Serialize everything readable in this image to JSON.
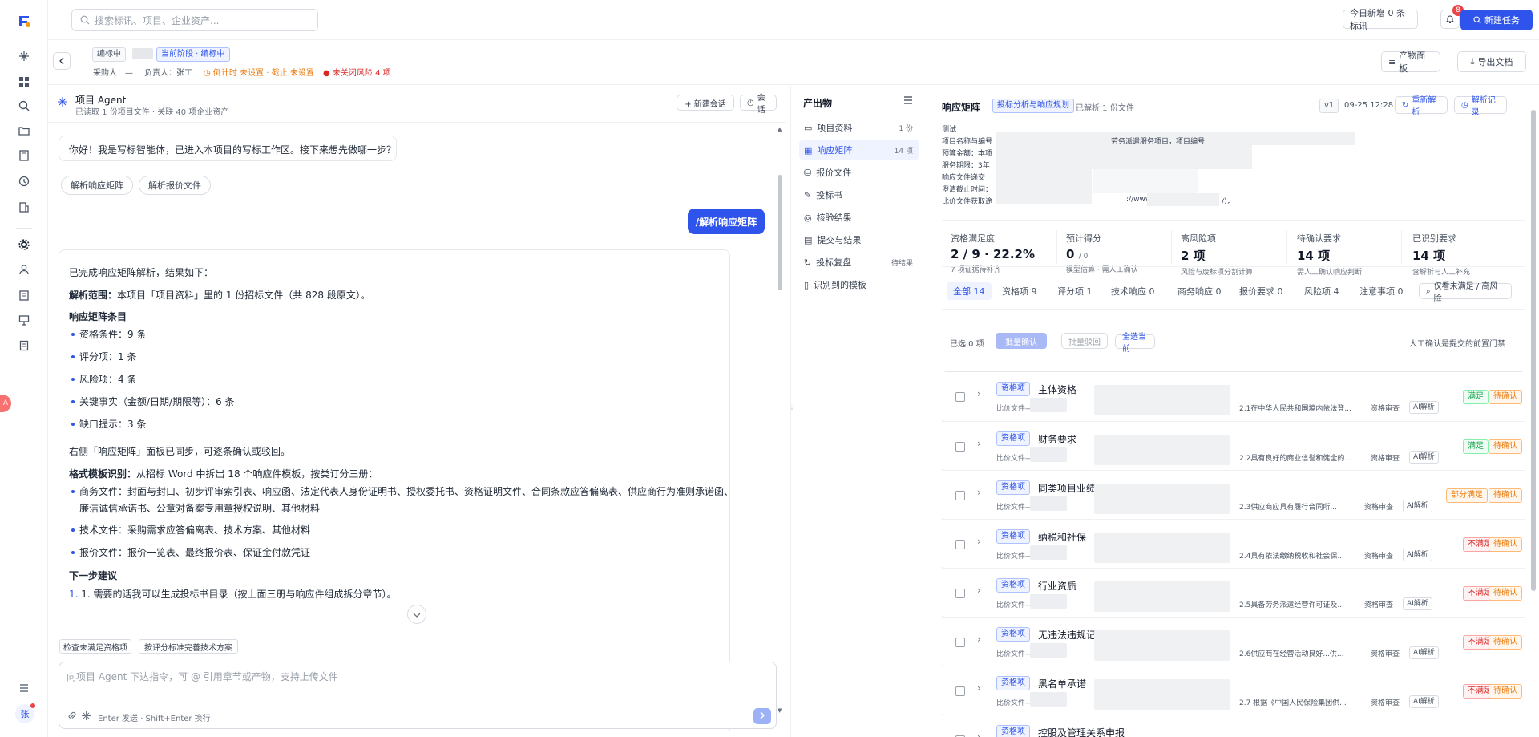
{
  "topbar": {
    "search_placeholder": "搜索标讯、项目、企业资产...",
    "daily_new": "今日新增 0 条标讯",
    "notify_count": "8",
    "new_task": "新建任务"
  },
  "project": {
    "status_tag": "编标中",
    "stage_tag": "当前阶段 · 编标中",
    "buyer": "采购人：—",
    "owner": "负责人：张工",
    "countdown": "倒计时 未设置 · 截止 未设置",
    "risk": "未关闭风险 4 项",
    "artifacts_btn": "产物面板",
    "export_btn": "导出文档"
  },
  "agent": {
    "title": "项目 Agent",
    "subtitle": "已读取 1 份项目文件 · 关联 40 项企业资产",
    "new_session": "+ 新建会话",
    "sessions": "会话",
    "greeting": "你好！我是写标智能体，已进入本项目的写标工作区。接下来想先做哪一步？",
    "chips": [
      "解析响应矩阵",
      "解析报价文件"
    ],
    "user_msg": "/解析响应矩阵",
    "reply": {
      "intro": "已完成响应矩阵解析，结果如下：",
      "scope_label": "解析范围：",
      "scope_text": "本项目「项目资料」里的 1 份招标文件（共 828 段原文）。",
      "entries_title": "响应矩阵条目",
      "entries": [
        "资格条件：9 条",
        "评分项：1 条",
        "风险项：4 条",
        "关键事实（金额/日期/期限等）：6 条",
        "缺口提示：3 条"
      ],
      "sync_note": "右侧「响应矩阵」面板已同步，可逐条确认或驳回。",
      "template_label": "格式模板识别：",
      "template_text": "从招标 Word 中拆出 18 个响应件模板，按类订分三册：",
      "template_items": [
        "商务文件：封面与封口、初步评审索引表、响应函、法定代表人身份证明书、授权委托书、资格证明文件、合同条款应答偏离表、供应商行为准则承诺函、",
        "廉洁诚信承诺书、公章对备案专用章授权说明、其他材料",
        "技术文件：采购需求应答偏离表、技术方案、其他材料",
        "报价文件：报价一览表、最终报价表、保证金付款凭证"
      ],
      "next_title": "下一步建议",
      "next_1": "1. 需要的话我可以生成投标书目录（按上面三册与响应件组成拆分章节）。"
    },
    "quick": [
      "检查未满足资格项",
      "按评分标准完善技术方案"
    ],
    "input_placeholder": "向项目 Agent 下达指令，可 @ 引用章节或产物，支持上传文件",
    "input_hint": "Enter 发送 · Shift+Enter 换行"
  },
  "outputs": {
    "title": "产出物",
    "items": [
      {
        "label": "项目资料",
        "count": "1 份"
      },
      {
        "label": "响应矩阵",
        "count": "14 项"
      },
      {
        "label": "报价文件",
        "count": ""
      },
      {
        "label": "投标书",
        "count": ""
      },
      {
        "label": "核验结果",
        "count": ""
      },
      {
        "label": "提交与结果",
        "count": ""
      },
      {
        "label": "投标复盘",
        "count": "待结果"
      },
      {
        "label": "识别到的模板",
        "count": ""
      }
    ]
  },
  "matrix": {
    "title": "响应矩阵",
    "tag": "投标分析与响应规划",
    "parsed": "已解析 1 份文件",
    "version": "v1",
    "time": "09-25 12:28",
    "reparse": "重新解析",
    "parse_log": "解析记录",
    "info": [
      "测试",
      "项目名称与编号",
      "劳务派遣服务项目，项目编号",
      "预算金额：本项",
      "服务期限：3年",
      "响应文件递交",
      "澄清截止时间：",
      "比价文件获取途",
      "://www",
      "/）。"
    ],
    "stats": [
      {
        "label": "资格满足度",
        "value": "2 / 9 · 22.2%",
        "sub": "7 项证据待补齐"
      },
      {
        "label": "预计得分",
        "value": "0",
        "value_sub": "/ 0",
        "sub": "模型估算 · 需人工确认"
      },
      {
        "label": "高风险项",
        "value": "2 项",
        "sub": "风险与废标项分割计算"
      },
      {
        "label": "待确认要求",
        "value": "14 项",
        "sub": "需人工确认响应判断"
      },
      {
        "label": "已识别要求",
        "value": "14 项",
        "sub": "含解析与人工补充"
      }
    ],
    "tabs": [
      "全部 14",
      "资格项 9",
      "评分项 1",
      "技术响应 0",
      "商务响应 0",
      "报价要求 0",
      "风险项 4",
      "注意事项 0"
    ],
    "only_unmet": "仅看未满足 / 高风险",
    "selected": "已选 0 项",
    "batch_confirm": "批量确认",
    "batch_reject": "批量驳回",
    "select_all": "全选当前",
    "gate_note": "人工确认是提交的前置门禁",
    "rows": [
      {
        "type": "资格项",
        "name": "主体资格",
        "src": "比价文件---",
        "clause": "2.1在中华人民共和国境内依法登...",
        "cat": "资格审查",
        "ai": "AI解析",
        "status": "满足",
        "st": "ok",
        "confirm": "待确认"
      },
      {
        "type": "资格项",
        "name": "财务要求",
        "src": "比价文件---",
        "clause": "2.2具有良好的商业信誉和健全的...",
        "cat": "资格审查",
        "ai": "AI解析",
        "status": "满足",
        "st": "ok",
        "confirm": "待确认"
      },
      {
        "type": "资格项",
        "name": "同类项目业绩",
        "src": "比价文件---",
        "clause": "2.3供应商应具有履行合同所...",
        "cat": "资格审查",
        "ai": "AI解析",
        "status": "部分满足",
        "st": "part",
        "confirm": "待确认"
      },
      {
        "type": "资格项",
        "name": "纳税和社保",
        "src": "比价文件---人",
        "clause": "2.4具有依法缴纳税收和社会保...",
        "cat": "资格审查",
        "ai": "AI解析",
        "status": "不满足",
        "st": "no",
        "confirm": "待确认"
      },
      {
        "type": "资格项",
        "name": "行业资质",
        "src": "比价文件---人",
        "clause": "2.5具备劳务派遣经营许可证及...",
        "cat": "资格审查",
        "ai": "AI解析",
        "status": "不满足",
        "st": "no",
        "confirm": "待确认"
      },
      {
        "type": "资格项",
        "name": "无违法违规记录",
        "src": "比价文件---人",
        "clause": "2.6供应商在经营活动良好...供...",
        "cat": "资格审查",
        "ai": "AI解析",
        "status": "不满足",
        "st": "no",
        "confirm": "待确认"
      },
      {
        "type": "资格项",
        "name": "黑名单承诺",
        "src": "比价文件---",
        "clause": "2.7 根据《中国人民保险集团供...",
        "cat": "资格审查",
        "ai": "AI解析",
        "status": "不满足",
        "st": "no",
        "confirm": "待确认"
      },
      {
        "type": "资格项",
        "name": "控股及管理关系申报",
        "src": "",
        "clause": "",
        "cat": "",
        "ai": "",
        "status": "",
        "st": "no",
        "confirm": ""
      }
    ]
  },
  "user": {
    "initial": "张"
  },
  "colors": {
    "accent": "#2f54eb",
    "ok": "#16a34a",
    "warn": "#ea7a0c",
    "danger": "#dc2626"
  }
}
